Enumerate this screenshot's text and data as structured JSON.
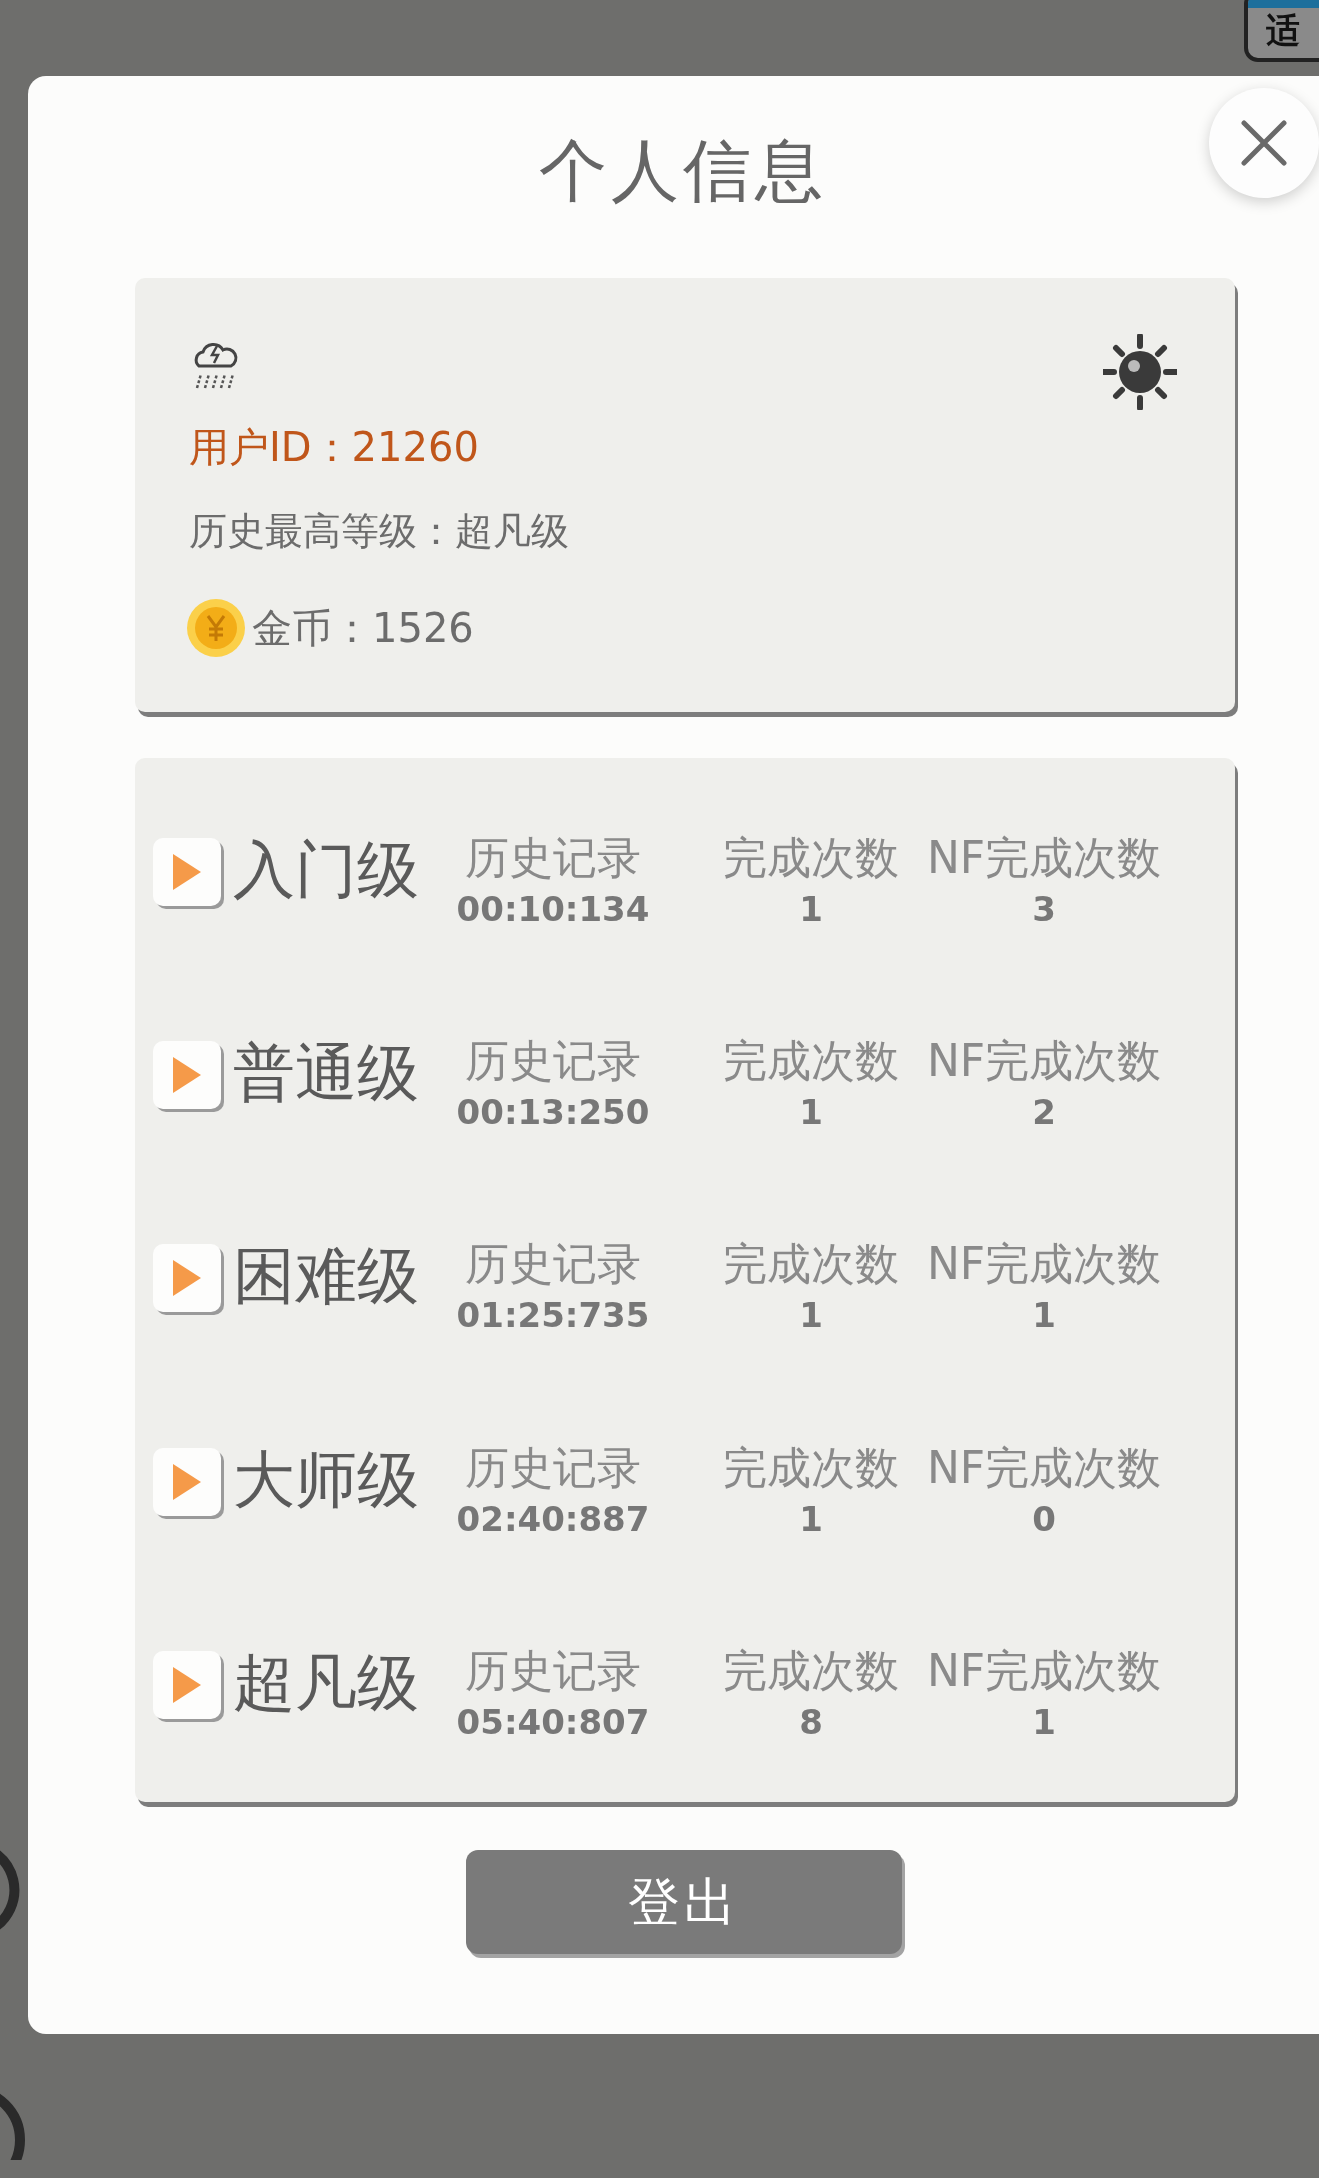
{
  "background_badge": {
    "text": "适"
  },
  "dialog": {
    "title": "个人信息"
  },
  "profile": {
    "user_id": "用户ID：21260",
    "highest_level": "历史最高等级：超凡级",
    "coins": "金币：1526"
  },
  "levels": [
    {
      "name": "入门级",
      "record_label": "历史记录",
      "record": "00:10:134",
      "completions_label": "完成次数",
      "completions": "1",
      "nf_label": "NF完成次数",
      "nf_completions": "3"
    },
    {
      "name": "普通级",
      "record_label": "历史记录",
      "record": "00:13:250",
      "completions_label": "完成次数",
      "completions": "1",
      "nf_label": "NF完成次数",
      "nf_completions": "2"
    },
    {
      "name": "困难级",
      "record_label": "历史记录",
      "record": "01:25:735",
      "completions_label": "完成次数",
      "completions": "1",
      "nf_label": "NF完成次数",
      "nf_completions": "1"
    },
    {
      "name": "大师级",
      "record_label": "历史记录",
      "record": "02:40:887",
      "completions_label": "完成次数",
      "completions": "1",
      "nf_label": "NF完成次数",
      "nf_completions": "0"
    },
    {
      "name": "超凡级",
      "record_label": "历史记录",
      "record": "05:40:807",
      "completions_label": "完成次数",
      "completions": "8",
      "nf_label": "NF完成次数",
      "nf_completions": "1"
    }
  ],
  "logout_button": {
    "label": "登出"
  }
}
